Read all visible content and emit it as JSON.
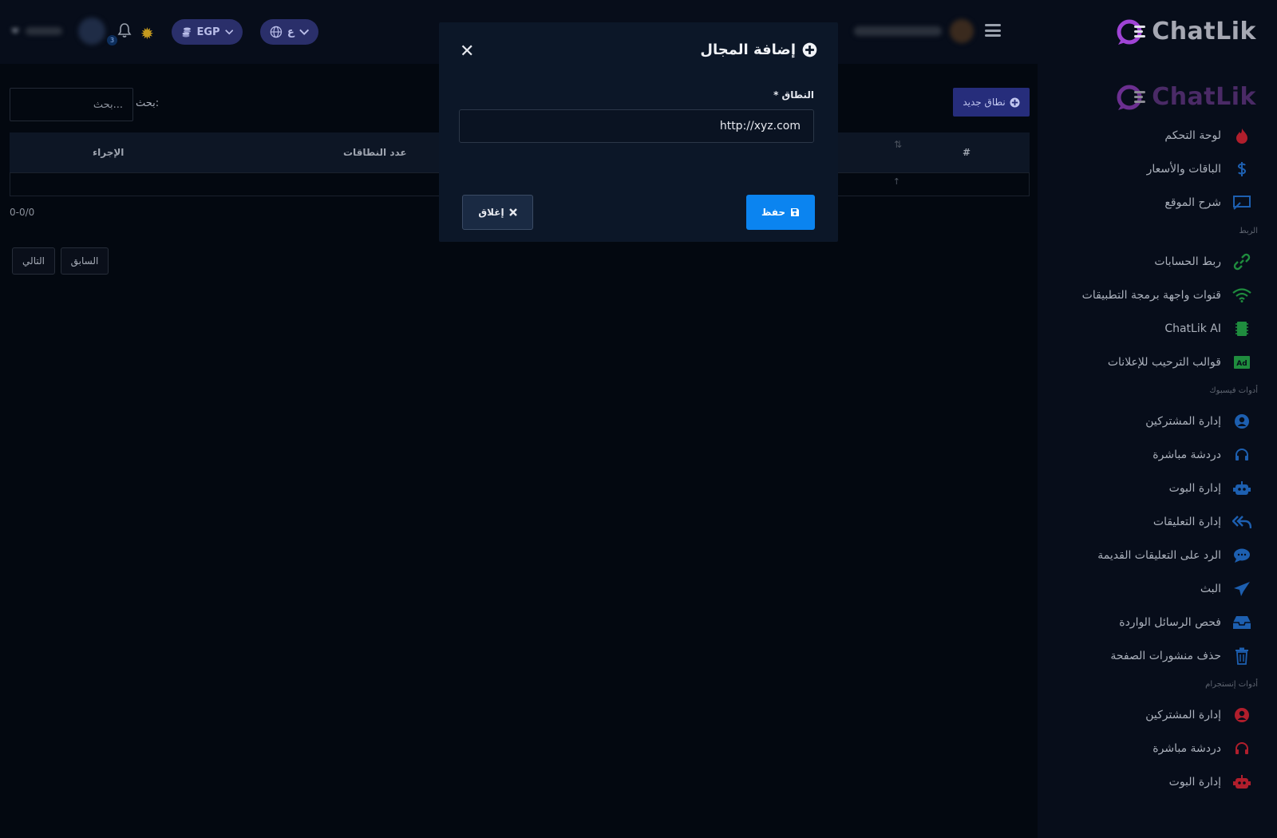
{
  "brand": {
    "name": "ChatLik",
    "accent": "#8c3fd0"
  },
  "header": {
    "language_label": "ع",
    "currency_label": "EGP",
    "notification_count": "3"
  },
  "sidebar": {
    "items": [
      {
        "label": "لوحة التحكم",
        "icon": "flame-icon",
        "color": "#b01e2c"
      },
      {
        "label": "الباقات والأسعار",
        "icon": "dollar-icon",
        "color": "#1d5fb0"
      },
      {
        "label": "شرح الموقع",
        "icon": "presentation-icon",
        "color": "#1d5fb0"
      },
      {
        "section": "الربط"
      },
      {
        "label": "ربط الحسابات",
        "icon": "link-icon",
        "color": "#1f8c3e"
      },
      {
        "label": "قنوات واجهة برمجة التطبيقات",
        "icon": "wifi-icon",
        "color": "#1f8c3e"
      },
      {
        "label": "ChatLik AI",
        "icon": "chip-icon",
        "color": "#1f8c3e"
      },
      {
        "label": "قوالب الترحيب للإعلانات",
        "icon": "ad-icon",
        "color": "#1f8c3e"
      },
      {
        "section": "أدوات فيسبوك"
      },
      {
        "label": "إدارة المشتركين",
        "icon": "user-circle-icon",
        "color": "#1d5fb0"
      },
      {
        "label": "دردشة مباشرة",
        "icon": "headset-icon",
        "color": "#1d5fb0"
      },
      {
        "label": "إدارة البوت",
        "icon": "robot-icon",
        "color": "#1d5fb0"
      },
      {
        "label": "إدارة التعليقات",
        "icon": "reply-all-icon",
        "color": "#1d5fb0"
      },
      {
        "label": "الرد على التعليقات القديمة",
        "icon": "comment-icon",
        "color": "#1d5fb0"
      },
      {
        "label": "البث",
        "icon": "paper-plane-icon",
        "color": "#1d5fb0"
      },
      {
        "label": "فحص الرسائل الواردة",
        "icon": "inbox-icon",
        "color": "#1d5fb0"
      },
      {
        "label": "حذف منشورات الصفحة",
        "icon": "trash-icon",
        "color": "#1d5fb0"
      },
      {
        "section": "أدوات إنستجرام"
      },
      {
        "label": "إدارة المشتركين",
        "icon": "user-circle-icon",
        "color": "#b01e2c"
      },
      {
        "label": "دردشة مباشرة",
        "icon": "headset-icon",
        "color": "#b01e2c"
      },
      {
        "label": "إدارة البوت",
        "icon": "robot-icon",
        "color": "#b01e2c"
      }
    ]
  },
  "content": {
    "new_button_label": "نطاق جديد",
    "search_label": "بحث:",
    "search_placeholder": "بحث...",
    "table": {
      "headers": {
        "index": "#",
        "count": "عدد النطاقات",
        "action": "الإجراء"
      },
      "sort_icon": "⇅",
      "row_arrow": "↑"
    },
    "info": "0-0/0",
    "pager": {
      "prev": "السابق",
      "next": "التالي"
    }
  },
  "modal": {
    "title": "إضافة المجال",
    "field_label": "النطاق *",
    "field_value": "http://xyz.com",
    "save_label": "حفظ",
    "cancel_label": "إغلاق",
    "close_glyph": "✕"
  }
}
